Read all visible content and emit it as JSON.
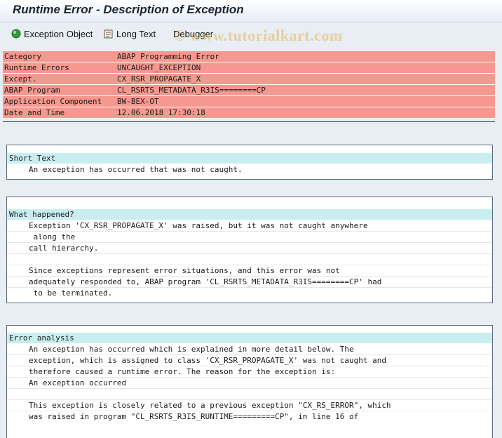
{
  "window": {
    "title": "Runtime Error - Description of Exception"
  },
  "toolbar": {
    "exception_object": "Exception Object",
    "long_text": "Long Text",
    "debugger": "Debugger"
  },
  "watermark": "© www.tutorialkart.com",
  "header_rows": [
    {
      "key": "Category",
      "value": "ABAP Programming Error"
    },
    {
      "key": "Runtime Errors",
      "value": "UNCAUGHT_EXCEPTION"
    },
    {
      "key": "Except.",
      "value": "CX_RSR_PROPAGATE_X"
    },
    {
      "key": "ABAP Program",
      "value": "CL_RSRTS_METADATA_R3IS========CP"
    },
    {
      "key": "Application Component",
      "value": "BW-BEX-OT"
    },
    {
      "key": "Date and Time",
      "value": "12.06.2018 17:30:18"
    }
  ],
  "sections": {
    "short_text": {
      "title": "Short Text",
      "lines": [
        "An exception has occurred that was not caught."
      ]
    },
    "what_happened": {
      "title": "What happened?",
      "lines": [
        "Exception 'CX_RSR_PROPAGATE_X' was raised, but it was not caught anywhere",
        " along the",
        "call hierarchy.",
        "",
        "Since exceptions represent error situations, and this error was not",
        "adequately responded to, ABAP program 'CL_RSRTS_METADATA_R3IS========CP' had",
        " to be terminated."
      ]
    },
    "error_analysis": {
      "title": "Error analysis",
      "lines": [
        "An exception has occurred which is explained in more detail below. The",
        "exception, which is assigned to class 'CX_RSR_PROPAGATE_X' was not caught and",
        "therefore caused a runtime error. The reason for the exception is:",
        "An exception occurred",
        "",
        "This exception is closely related to a previous exception \"CX_RS_ERROR\", which",
        "was raised in program \"CL_RSRTS_R3IS_RUNTIME=========CP\", in line 16 of"
      ]
    }
  }
}
